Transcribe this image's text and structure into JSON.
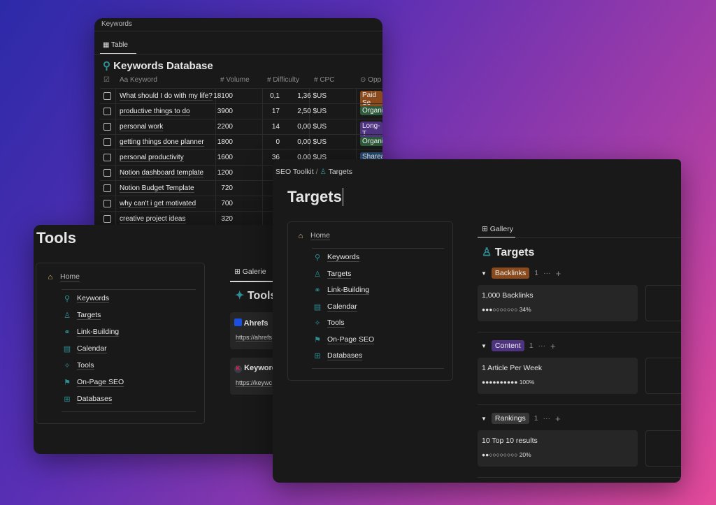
{
  "keywords_window": {
    "title": "Keywords",
    "tab": "Table",
    "heading": "Keywords Database",
    "columns": [
      "Aa Keyword",
      "# Volume",
      "# Difficulty",
      "# CPC",
      "Opp"
    ],
    "rows": [
      {
        "keyword": "What should I do with my life?",
        "volume": "18100",
        "difficulty": "0,1",
        "cpc": "1,36 $US",
        "opp": "Paid Se",
        "opp_color": "#8a4a1c"
      },
      {
        "keyword": "productive things to do",
        "volume": "3900",
        "difficulty": "17",
        "cpc": "2,50 $US",
        "opp": "Organi",
        "opp_color": "#2c5a3a"
      },
      {
        "keyword": "personal work",
        "volume": "2200",
        "difficulty": "14",
        "cpc": "0,00 $US",
        "opp": "Long-T",
        "opp_color": "#4d3380"
      },
      {
        "keyword": "getting things done planner",
        "volume": "1800",
        "difficulty": "0",
        "cpc": "0,00 $US",
        "opp": "Organi",
        "opp_color": "#2c5a3a"
      },
      {
        "keyword": "personal productivity",
        "volume": "1600",
        "difficulty": "36",
        "cpc": "0,00 $US",
        "opp": "Shareal",
        "opp_color": "#254a70"
      },
      {
        "keyword": "Notion dashboard template",
        "volume": "1200"
      },
      {
        "keyword": "Notion Budget Template",
        "volume": "720"
      },
      {
        "keyword": "why can't i get motivated",
        "volume": "700"
      },
      {
        "keyword": "creative project ideas",
        "volume": "320"
      }
    ]
  },
  "tools_window": {
    "title": "Tools",
    "nav": {
      "home": "Home",
      "items": [
        {
          "label": "Keywords",
          "icon": "search-icon"
        },
        {
          "label": "Targets",
          "icon": "person-icon"
        },
        {
          "label": "Link-Building",
          "icon": "link-icon"
        },
        {
          "label": "Calendar",
          "icon": "calendar-icon"
        },
        {
          "label": "Tools",
          "icon": "sparkle-icon"
        },
        {
          "label": "On-Page SEO",
          "icon": "signpost-icon"
        },
        {
          "label": "Databases",
          "icon": "database-icon"
        }
      ]
    },
    "tab": "Galerie",
    "heading": "Tools",
    "cards": [
      {
        "name": "Ahrefs",
        "url": "https://ahrefs"
      },
      {
        "name": "Keyword",
        "url": "https://keywc"
      }
    ]
  },
  "targets_window": {
    "breadcrumb": [
      "SEO Toolkit",
      "Targets"
    ],
    "title": "Targets",
    "nav": {
      "home": "Home",
      "items": [
        {
          "label": "Keywords",
          "icon": "search-icon"
        },
        {
          "label": "Targets",
          "icon": "person-icon"
        },
        {
          "label": "Link-Building",
          "icon": "link-icon"
        },
        {
          "label": "Calendar",
          "icon": "calendar-icon"
        },
        {
          "label": "Tools",
          "icon": "sparkle-icon"
        },
        {
          "label": "On-Page SEO",
          "icon": "signpost-icon"
        },
        {
          "label": "Databases",
          "icon": "database-icon"
        }
      ]
    },
    "tab": "Gallery",
    "heading": "Targets",
    "groups": [
      {
        "label": "Backlinks",
        "color": "#8a4a1c",
        "count": "1",
        "card": "1,000 Backlinks",
        "progress": "●●●○○○○○○○ 34%",
        "percent": 34
      },
      {
        "label": "Content",
        "color": "#4d3380",
        "count": "1",
        "card": "1 Article Per Week",
        "progress": "●●●●●●●●●● 100%",
        "percent": 100
      },
      {
        "label": "Rankings",
        "color": "#373737",
        "count": "1",
        "card": "10 Top 10 results",
        "progress": "●●○○○○○○○○ 20%",
        "percent": 20
      }
    ]
  }
}
